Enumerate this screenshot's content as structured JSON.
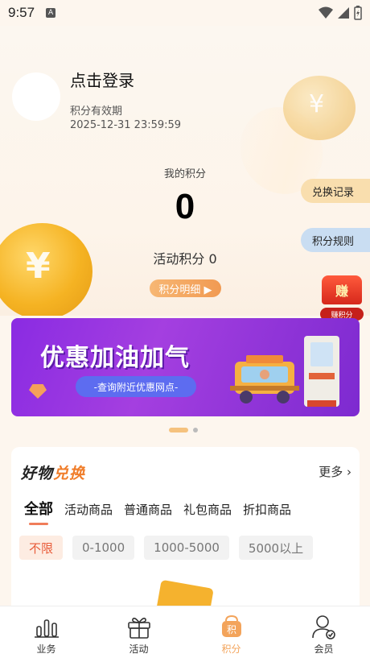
{
  "status_bar": {
    "time": "9:57",
    "notification_letter": "A"
  },
  "user": {
    "login_text": "点击登录",
    "expiry_label": "积分有效期",
    "expiry_date": "2025-12-31 23:59:59"
  },
  "points": {
    "label": "我的积分",
    "value": "0",
    "activity_label": "活动积分 0",
    "detail_button": "积分明细 ▶"
  },
  "side_buttons": {
    "exchange_record": "兑换记录",
    "points_rules": "积分规则"
  },
  "earn_badge": {
    "top": "赚",
    "bottom": "赚积分"
  },
  "banner": {
    "title": "优惠加油加气",
    "subtitle": "-查询附近优惠网点-"
  },
  "carousel": {
    "total": 2,
    "active_index": 0
  },
  "goods": {
    "title_part1": "好物",
    "title_part2": "兑换",
    "more_label": "更多 ›",
    "tabs": [
      "全部",
      "活动商品",
      "普通商品",
      "礼包商品",
      "折扣商品"
    ],
    "active_tab": 0,
    "price_filters": [
      "不限",
      "0-1000",
      "1000-5000",
      "5000以上"
    ],
    "active_filter": 0
  },
  "tabbar": {
    "items": [
      {
        "label": "业务",
        "icon": "bar-chart-icon"
      },
      {
        "label": "活动",
        "icon": "gift-icon"
      },
      {
        "label": "积分",
        "icon": "points-bag-icon"
      },
      {
        "label": "会员",
        "icon": "member-icon"
      }
    ],
    "active_index": 2
  },
  "colors": {
    "accent": "#f3a45b",
    "banner": "#8a2be2",
    "active_chip_text": "#e85c3a"
  }
}
